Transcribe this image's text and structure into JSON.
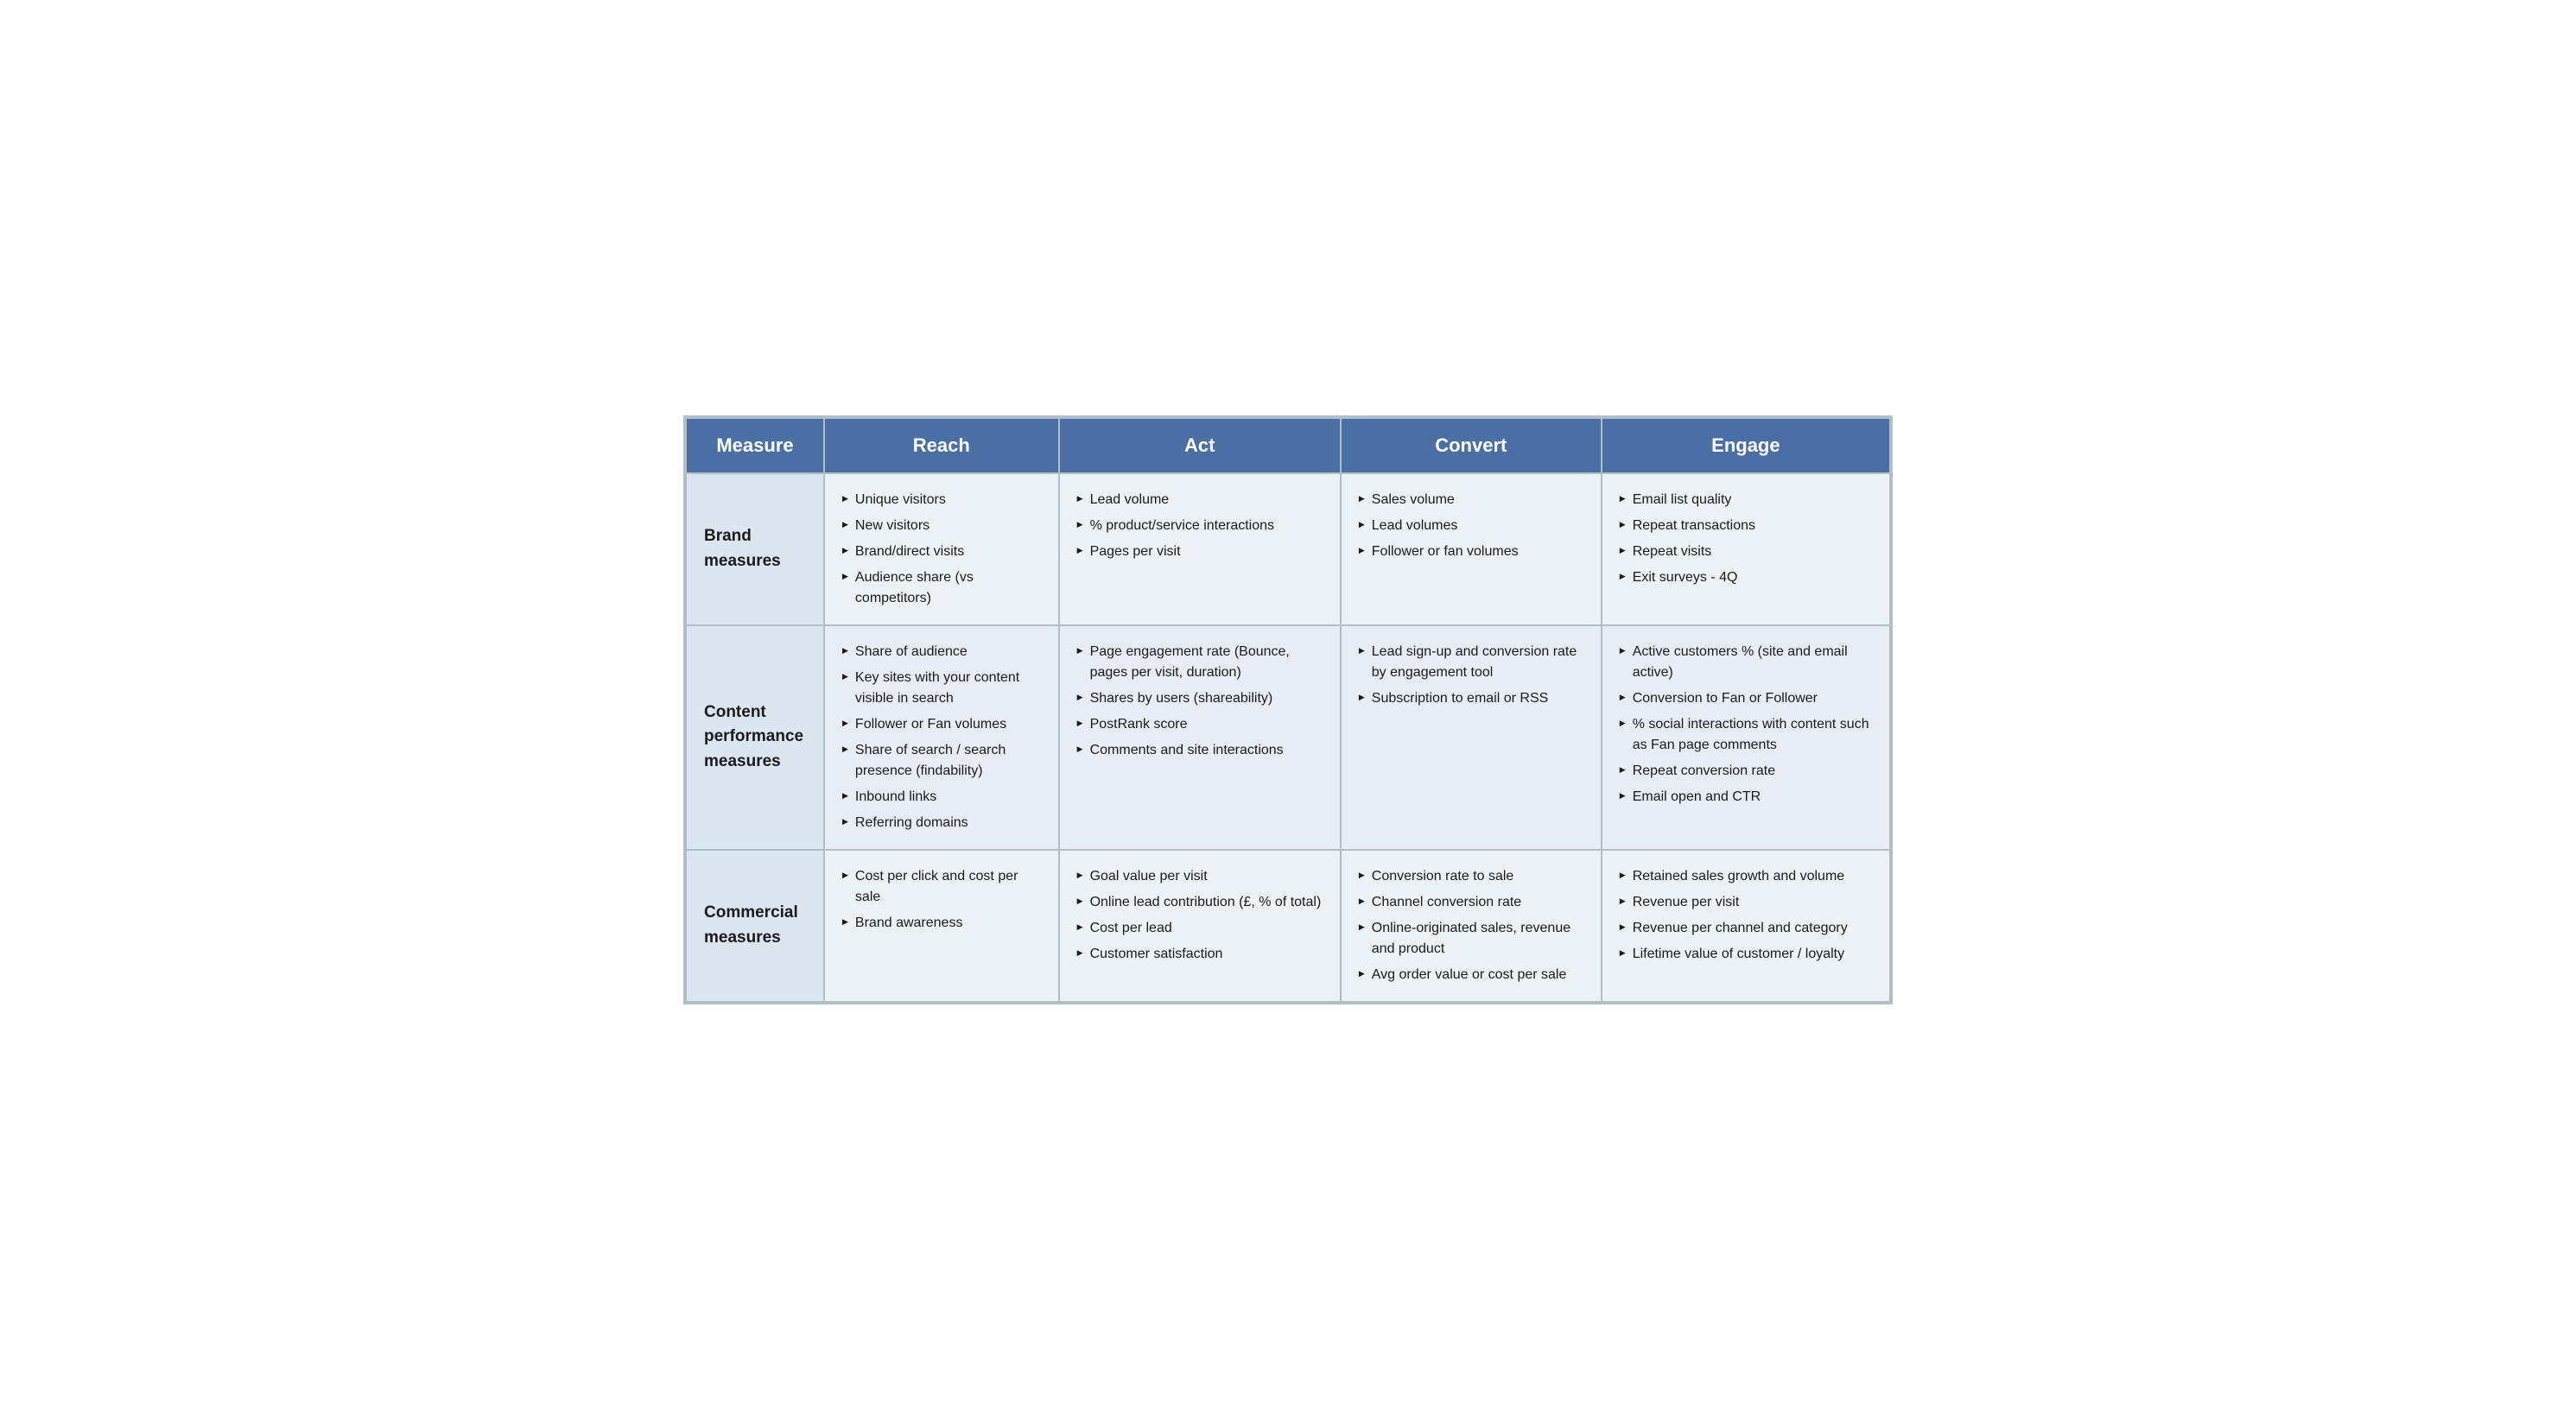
{
  "header": {
    "col1": "Measure",
    "col2": "Reach",
    "col3": "Act",
    "col4": "Convert",
    "col5": "Engage"
  },
  "rows": [
    {
      "rowLabel": "Brand measures",
      "reach": [
        "Unique visitors",
        "New visitors",
        "Brand/direct visits",
        "Audience share (vs competitors)"
      ],
      "act": [
        "Lead volume",
        "% product/service interactions",
        "Pages per visit"
      ],
      "convert": [
        "Sales volume",
        "Lead volumes",
        "Follower or fan volumes"
      ],
      "engage": [
        "Email list quality",
        "Repeat transactions",
        "Repeat visits",
        "Exit surveys - 4Q"
      ]
    },
    {
      "rowLabel": "Content performance measures",
      "reach": [
        "Share of audience",
        "Key sites with your content visible in search",
        "Follower or Fan volumes",
        "Share of search / search presence (findability)",
        "Inbound links",
        "Referring domains"
      ],
      "act": [
        "Page engagement rate (Bounce, pages per visit, duration)",
        "Shares by users (shareability)",
        "PostRank score",
        "Comments and site interactions"
      ],
      "convert": [
        "Lead sign-up and conversion rate by engagement tool",
        "Subscription to email or RSS"
      ],
      "engage": [
        "Active customers % (site and email active)",
        "Conversion to Fan or Follower",
        "% social interactions with content such as Fan page comments",
        "Repeat conversion rate",
        "Email open and CTR"
      ]
    },
    {
      "rowLabel": "Commercial measures",
      "reach": [
        "Cost per click and cost per sale",
        "Brand awareness"
      ],
      "act": [
        "Goal value per visit",
        "Online lead contribution (£, % of total)",
        "Cost per lead",
        "Customer satisfaction"
      ],
      "convert": [
        "Conversion rate to sale",
        "Channel conversion rate",
        "Online-originated sales, revenue and product",
        "Avg order value or cost per sale"
      ],
      "engage": [
        "Retained sales growth and volume",
        "Revenue per visit",
        "Revenue per channel and category",
        "Lifetime value of customer / loyalty"
      ]
    }
  ]
}
